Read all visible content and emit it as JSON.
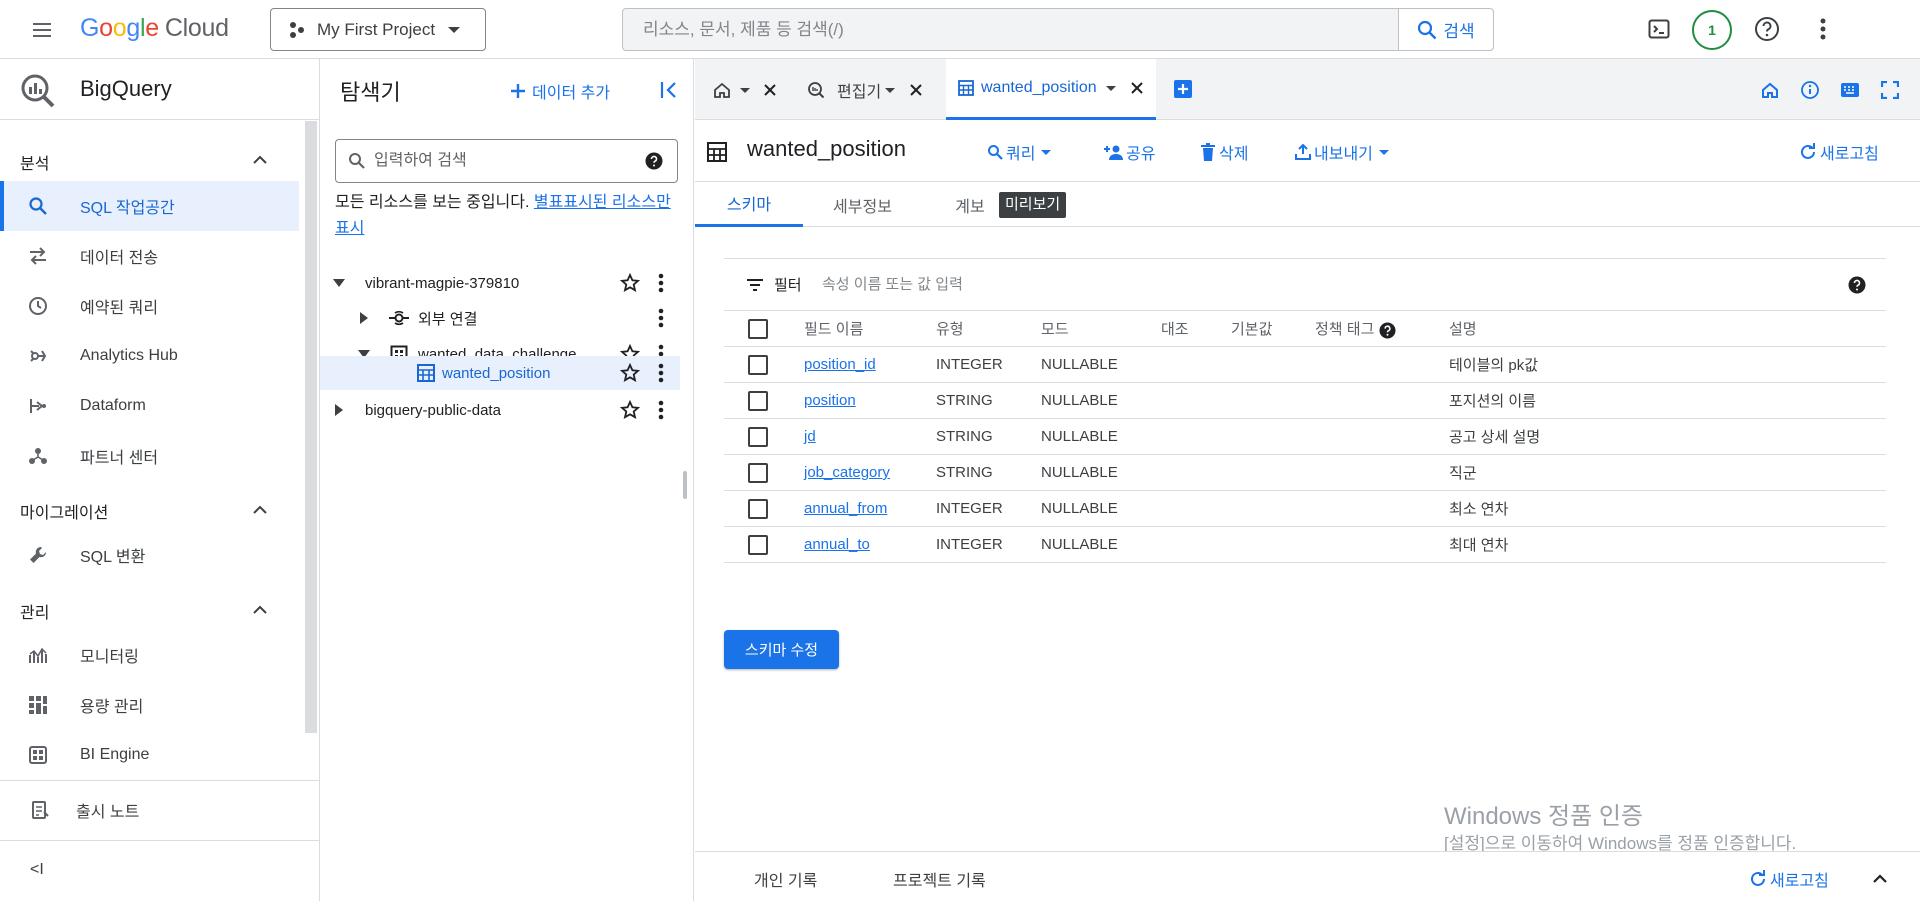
{
  "header": {
    "logo_google": "Google",
    "logo_cloud": "Cloud",
    "project": "My First Project",
    "search_placeholder": "리소스, 문서, 제품 등 검색(/)",
    "search_button": "검색",
    "avatar": "1"
  },
  "leftnav": {
    "product": "BigQuery",
    "sections": {
      "analysis": "분석",
      "migration": "마이그레이션",
      "admin": "관리"
    },
    "items": [
      {
        "label": "SQL 작업공간",
        "icon": "search-icon"
      },
      {
        "label": "데이터 전송",
        "icon": "transfer-icon"
      },
      {
        "label": "예약된 쿼리",
        "icon": "clock-icon"
      },
      {
        "label": "Analytics Hub",
        "icon": "hub-icon"
      },
      {
        "label": "Dataform",
        "icon": "dataform-icon"
      },
      {
        "label": "파트너 센터",
        "icon": "partner-icon"
      },
      {
        "label": "SQL 변환",
        "icon": "wrench-icon"
      },
      {
        "label": "모니터링",
        "icon": "monitor-icon"
      },
      {
        "label": "용량 관리",
        "icon": "capacity-icon"
      },
      {
        "label": "BI Engine",
        "icon": "bi-engine-icon"
      }
    ],
    "release_notes": "출시 노트",
    "collapse": "<I"
  },
  "explorer": {
    "title": "탐색기",
    "add_data": "데이터 추가",
    "search_placeholder": "입력하여 검색",
    "note_text": "모든 리소스를 보는 중입니다. ",
    "note_link": "별표표시된 리소스만 표시",
    "tree": [
      {
        "label": "vibrant-magpie-379810"
      },
      {
        "label": "외부 연결"
      },
      {
        "label": "wanted_data_challenge"
      },
      {
        "label": "wanted_position"
      },
      {
        "label": "bigquery-public-data"
      }
    ]
  },
  "tabs": {
    "editor": "편집기",
    "table_tab": "wanted_position"
  },
  "resource": {
    "title": "wanted_position",
    "actions": {
      "query": "쿼리",
      "share": "공유",
      "delete": "삭제",
      "export": "내보내기",
      "refresh": "새로고침"
    },
    "subtabs": {
      "schema": "스키마",
      "details": "세부정보",
      "lineage": "계보",
      "preview": "미리보기"
    }
  },
  "schema": {
    "filter_label": "필터",
    "filter_placeholder": "속성 이름 또는 값 입력",
    "columns": [
      "필드 이름",
      "유형",
      "모드",
      "대조",
      "기본값",
      "정책 태그",
      "설명"
    ],
    "rows": [
      {
        "name": "position_id",
        "type": "INTEGER",
        "mode": "NULLABLE",
        "desc": "테이블의 pk값"
      },
      {
        "name": "position",
        "type": "STRING",
        "mode": "NULLABLE",
        "desc": "포지션의 이름"
      },
      {
        "name": "jd",
        "type": "STRING",
        "mode": "NULLABLE",
        "desc": "공고 상세 설명"
      },
      {
        "name": "job_category",
        "type": "STRING",
        "mode": "NULLABLE",
        "desc": "직군"
      },
      {
        "name": "annual_from",
        "type": "INTEGER",
        "mode": "NULLABLE",
        "desc": "최소 연차"
      },
      {
        "name": "annual_to",
        "type": "INTEGER",
        "mode": "NULLABLE",
        "desc": "최대 연차"
      }
    ],
    "edit_button": "스키마 수정"
  },
  "watermark": {
    "line1": "Windows 정품 인증",
    "line2": "[설정]으로 이동하여 Windows를 정품 인증합니다."
  },
  "history": {
    "personal": "개인 기록",
    "project": "프로젝트 기록",
    "refresh": "새로고침"
  }
}
